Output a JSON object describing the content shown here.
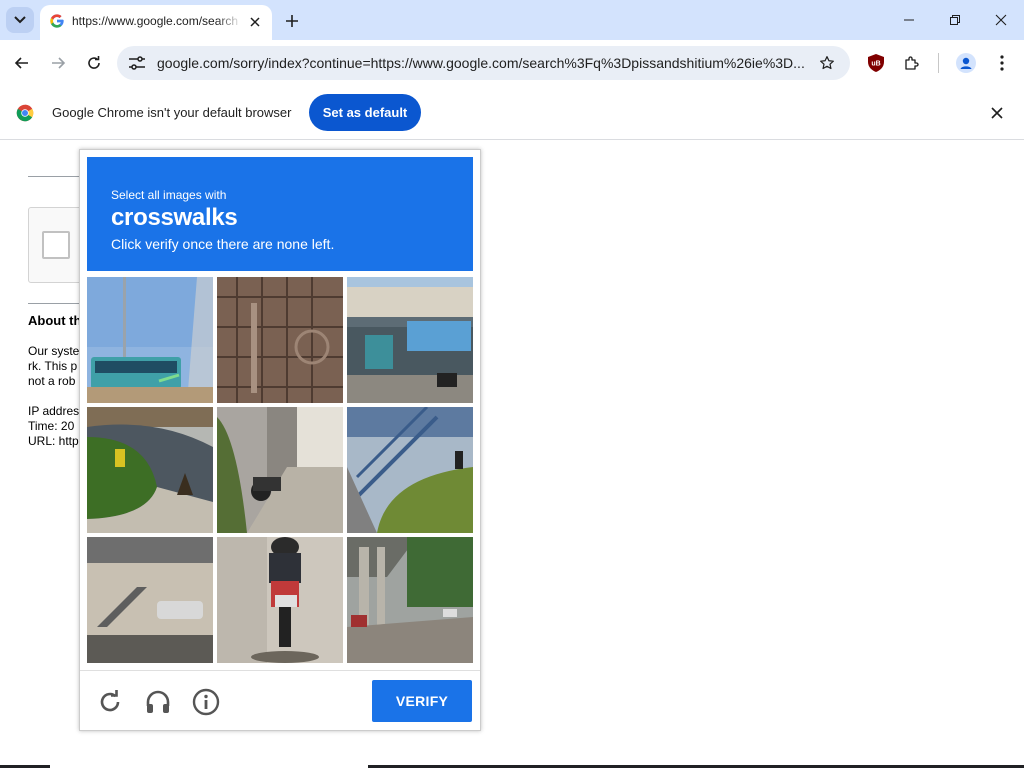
{
  "browser": {
    "tab": {
      "title": "https://www.google.com/search"
    },
    "address_bar": {
      "url": "google.com/sorry/index?continue=https://www.google.com/search%3Fq%3Dpissandshitium%26ie%3D..."
    },
    "infobar": {
      "message": "Google Chrome isn't your default browser",
      "button_label": "Set as default"
    },
    "extension_badge": "uB"
  },
  "page": {
    "about_heading": "About th",
    "paragraph_lines": [
      "Our syste",
      "rk. This p",
      "not a rob"
    ],
    "details_lines": [
      "IP addres",
      "Time: 20",
      "URL: http"
    ]
  },
  "captcha": {
    "prompt_select": "Select all images with",
    "prompt_object": "crosswalks",
    "prompt_instruction": "Click verify once there are none left.",
    "verify_label": "VERIFY",
    "tiles": [
      {
        "id": 1,
        "scene": "bus-on-road"
      },
      {
        "id": 2,
        "scene": "metal-gate"
      },
      {
        "id": 3,
        "scene": "storefront"
      },
      {
        "id": 4,
        "scene": "curb-hydrant"
      },
      {
        "id": 5,
        "scene": "sidewalk-motorbike"
      },
      {
        "id": 6,
        "scene": "stairs-bridge"
      },
      {
        "id": 7,
        "scene": "house-stairs"
      },
      {
        "id": 8,
        "scene": "motorcycle-rider"
      },
      {
        "id": 9,
        "scene": "overpass-street"
      }
    ]
  },
  "colors": {
    "tabstrip": "#d3e3fd",
    "captcha_blue": "#1a73e8",
    "default_button": "#0b57d0"
  }
}
